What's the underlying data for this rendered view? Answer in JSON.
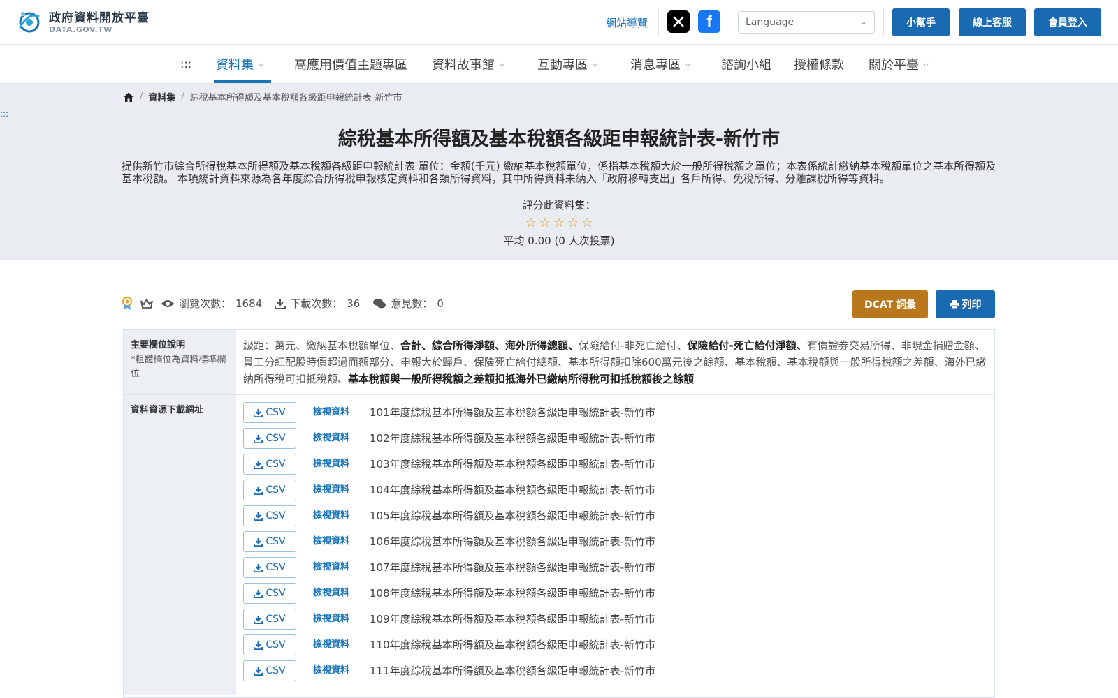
{
  "header": {
    "logo_name": "政府資料開放平臺",
    "logo_sub": "DATA.GOV.TW",
    "sitemap": "網站導覽",
    "language_placeholder": "Language",
    "buttons": [
      "小幫手",
      "線上客服",
      "會員登入"
    ]
  },
  "nav": {
    "accesskey": ":::",
    "items": [
      {
        "label": "資料集",
        "dropdown": true,
        "active": true
      },
      {
        "label": "高應用價值主題專區",
        "dropdown": false
      },
      {
        "label": "資料故事館",
        "dropdown": true
      },
      {
        "label": "互動專區",
        "dropdown": true
      },
      {
        "label": "消息專區",
        "dropdown": true
      },
      {
        "label": "諮詢小組",
        "dropdown": false
      },
      {
        "label": "授權條款",
        "dropdown": false
      },
      {
        "label": "關於平臺",
        "dropdown": true
      }
    ]
  },
  "breadcrumb": {
    "section": "資料集",
    "current": "綜稅基本所得額及基本稅額各級距申報統計表-新竹市"
  },
  "left_accesskey": ":::",
  "dataset": {
    "title": "綜稅基本所得額及基本稅額各級距申報統計表-新竹市",
    "description": "提供新竹市綜合所得稅基本所得額及基本稅額各級距申報統計表 單位：金額(千元) 繳納基本稅額單位，係指基本稅額大於一般所得稅額之單位；本表係統計繳納基本稅額單位之基本所得額及基本稅額。 本項統計資料來源為各年度綜合所得稅申報核定資料和各類所得資料，其中所得資料未納入「政府移轉支出」各戶所得、免稅所得、分離課稅所得等資料。",
    "rating_label": "評分此資料集：",
    "rating_stars": 5,
    "rating_avg": "平均 0.00 (0 人次投票)"
  },
  "stats": {
    "views_label": "瀏覽次數：",
    "views": "1684",
    "downloads_label": "下載次數：",
    "downloads": "36",
    "comments_label": "意見數：",
    "comments": "0"
  },
  "actions": {
    "dcat": "DCAT 詞彙",
    "print": "列印"
  },
  "fields_row": {
    "header": "主要欄位說明",
    "note": "*粗體欄位為資料標準欄位",
    "segments": [
      {
        "text": "級距：萬元、繳納基本稅額單位、",
        "bold": false
      },
      {
        "text": "合計、綜合所得淨額、海外所得總額、",
        "bold": true
      },
      {
        "text": "保險給付-非死亡給付、",
        "bold": false
      },
      {
        "text": "保險給付-死亡給付淨額、",
        "bold": true
      },
      {
        "text": "有價證券交易所得、非現金捐贈金額、員工分紅配股時價超過面額部分、申報大於歸戶、保險死亡給付總額、基本所得額扣除600萬元後之餘額、基本稅額、基本稅額與一般所得稅額之差額、海外已繳納所得稅可扣抵稅額、",
        "bold": false
      },
      {
        "text": "基本稅額與一般所得稅額之差額扣抵海外已繳納所得稅可扣抵稅額後之餘額",
        "bold": true
      }
    ]
  },
  "resources_row": {
    "header": "資料資源下載網址",
    "csv_label": "CSV",
    "view_label": "檢視資料",
    "items": [
      "101年度綜稅基本所得額及基本稅額各級距申報統計表-新竹市",
      "102年度綜稅基本所得額及基本稅額各級距申報統計表-新竹市",
      "103年度綜稅基本所得額及基本稅額各級距申報統計表-新竹市",
      "104年度綜稅基本所得額及基本稅額各級距申報統計表-新竹市",
      "105年度綜稅基本所得額及基本稅額各級距申報統計表-新竹市",
      "106年度綜稅基本所得額及基本稅額各級距申報統計表-新竹市",
      "107年度綜稅基本所得額及基本稅額各級距申報統計表-新竹市",
      "108年度綜稅基本所得額及基本稅額各級距申報統計表-新竹市",
      "109年度綜稅基本所得額及基本稅額各級距申報統計表-新竹市",
      "110年度綜稅基本所得額及基本稅額各級距申報統計表-新竹市",
      "111年度綜稅基本所得額及基本稅額各級距申報統計表-新竹市"
    ]
  },
  "colors": {
    "primary": "#1a6ab1",
    "link": "#1a74b8",
    "dcat": "#b8781b",
    "star": "#e0a12a",
    "hero_bg": "#e9edf2"
  }
}
